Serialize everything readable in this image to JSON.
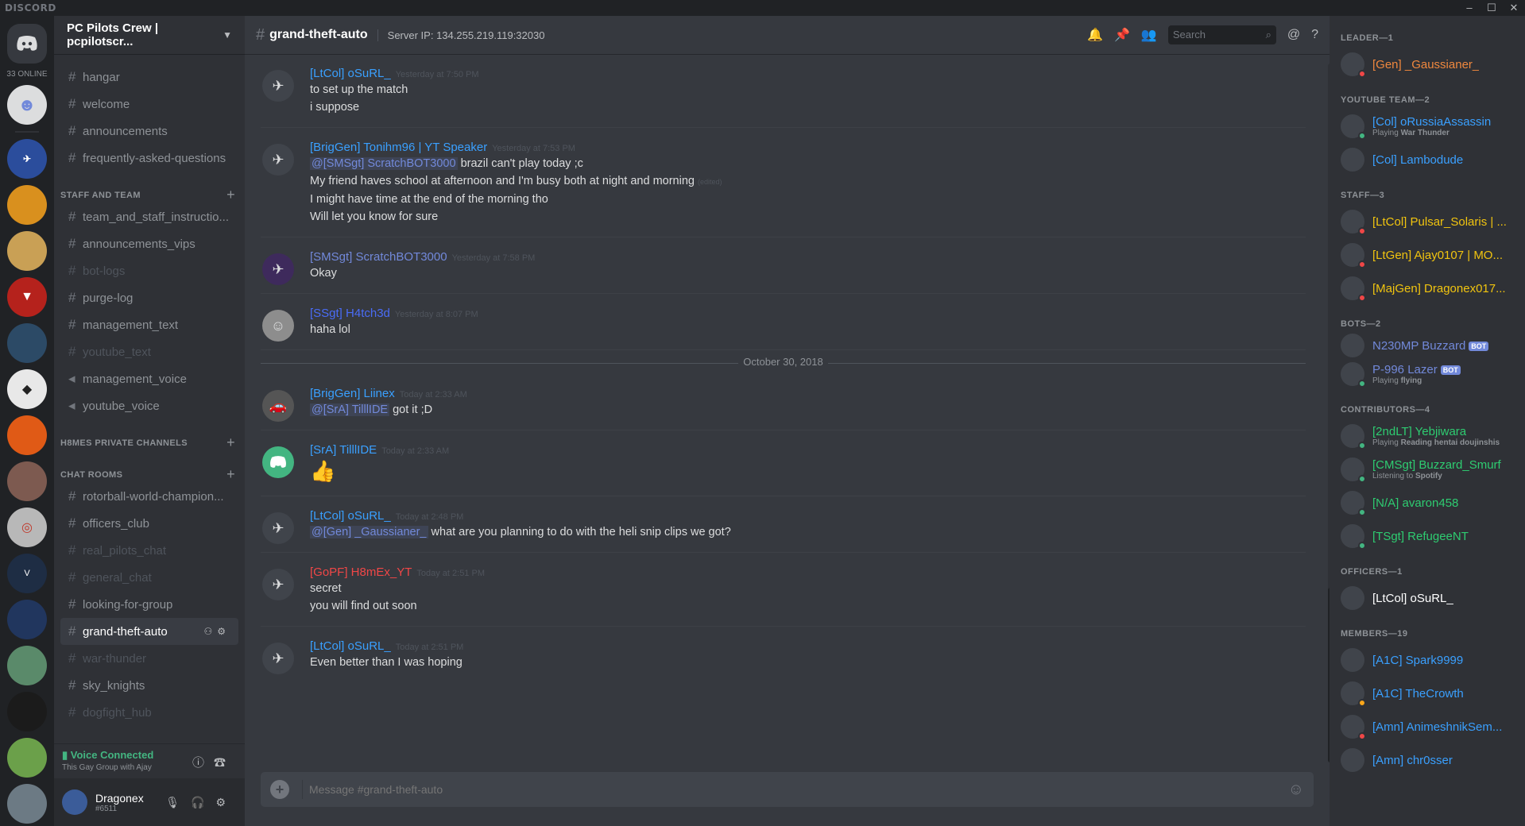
{
  "app": {
    "brand": "DISCORD"
  },
  "servers": {
    "online_count": "33 ONLINE"
  },
  "guild": {
    "name": "PC Pilots Crew | pcpilotscr..."
  },
  "channels": {
    "top": [
      "hangar",
      "welcome",
      "announcements",
      "frequently-asked-questions"
    ],
    "staff_category": "STAFF AND TEAM",
    "staff": [
      "team_and_staff_instructio...",
      "announcements_vips",
      "bot-logs",
      "purge-log",
      "management_text",
      "youtube_text",
      "management_voice",
      "youtube_voice"
    ],
    "h8mes_category": "H8MES PRIVATE CHANNELS",
    "chat_category": "CHAT ROOMS",
    "chat": [
      "rotorball-world-champion...",
      "officers_club",
      "real_pilots_chat",
      "general_chat",
      "looking-for-group",
      "grand-theft-auto",
      "war-thunder",
      "sky_knights",
      "dogfight_hub"
    ]
  },
  "voice": {
    "status": "Voice Connected",
    "channel": "This Gay Group with Ajay"
  },
  "user": {
    "name": "Dragonex",
    "discriminator": "#6511"
  },
  "header": {
    "channel": "grand-theft-auto",
    "topic": "Server IP: 134.255.219.119:32030",
    "search_placeholder": "Search"
  },
  "messages": [
    {
      "author": "[LtCol] oSuRL_",
      "time": "Yesterday at 7:50 PM",
      "lines": [
        "to set up the match",
        "i suppose"
      ]
    },
    {
      "author": "[BrigGen] Tonihm96 | YT Speaker",
      "time": "Yesterday at 7:53 PM",
      "mention": "@[SMSgt] ScratchBOT3000",
      "mention_rest": " brazil can't play today ;c",
      "lines": [
        "My friend haves school at afternoon and I'm busy both at night and morning",
        "I might have time at the end of the morning tho",
        "Will let you know for sure"
      ],
      "edited": "(edited)"
    },
    {
      "author": "[SMSgt] ScratchBOT3000",
      "time": "Yesterday at 7:58 PM",
      "lines": [
        "Okay"
      ]
    },
    {
      "author": "[SSgt] H4tch3d",
      "time": "Yesterday at 8:07 PM",
      "lines": [
        "haha lol"
      ]
    },
    {
      "author": "[BrigGen] Liinex",
      "time": "Today at 2:33 AM",
      "mention": "@[SrA] TilllIDE",
      "mention_rest": " got it ;D"
    },
    {
      "author": "[SrA] TilllIDE",
      "time": "Today at 2:33 AM",
      "emoji": "👍"
    },
    {
      "author": "[LtCol] oSuRL_",
      "time": "Today at 2:48 PM",
      "mention": "@[Gen] _Gaussianer_",
      "mention_rest": " what are you planning to do with the heli snip clips we got?"
    },
    {
      "author": "[GoPF] H8mEx_YT",
      "time": "Today at 2:51 PM",
      "lines": [
        "secret",
        "you will find out soon"
      ]
    },
    {
      "author": "[LtCol] oSuRL_",
      "time": "Today at 2:51 PM",
      "lines": [
        "Even better than I was hoping"
      ]
    }
  ],
  "date_divider": "October 30, 2018",
  "composer": {
    "placeholder": "Message #grand-theft-auto"
  },
  "members": {
    "groups": [
      {
        "title": "LEADER—1",
        "items": [
          {
            "name": "[Gen] _Gaussianer_",
            "color": "#f0883e",
            "status": "#f04747"
          }
        ]
      },
      {
        "title": "YOUTUBE TEAM—2",
        "items": [
          {
            "name": "[Col] oRussiaAssassin",
            "color": "#3aa0ff",
            "status": "#43b581",
            "act_label": "Playing ",
            "act": "War Thunder"
          },
          {
            "name": "[Col] Lambodude",
            "color": "#3aa0ff",
            "status": ""
          }
        ]
      },
      {
        "title": "STAFF—3",
        "items": [
          {
            "name": "[LtCol] Pulsar_Solaris | ...",
            "color": "#f1c40f",
            "status": "#f04747"
          },
          {
            "name": "[LtGen] Ajay0107 | MO...",
            "color": "#f1c40f",
            "status": "#f04747"
          },
          {
            "name": "[MajGen] Dragonex017...",
            "color": "#f1c40f",
            "status": "#f04747"
          }
        ]
      },
      {
        "title": "BOTS—2",
        "items": [
          {
            "name": "N230MP Buzzard",
            "color": "#7289da",
            "status": "",
            "bot": "BOT"
          },
          {
            "name": "P-996 Lazer",
            "color": "#7289da",
            "status": "#43b581",
            "bot": "BOT",
            "act_label": "Playing ",
            "act": "flying"
          }
        ]
      },
      {
        "title": "CONTRIBUTORS—4",
        "items": [
          {
            "name": "[2ndLT] Yebjiwara",
            "color": "#2ecc71",
            "status": "#43b581",
            "act_label": "Playing ",
            "act": "Reading hentai doujinshis"
          },
          {
            "name": "[CMSgt] Buzzard_Smurf",
            "color": "#2ecc71",
            "status": "#43b581",
            "act_label": "Listening to ",
            "act": "Spotify"
          },
          {
            "name": "[N/A] avaron458",
            "color": "#2ecc71",
            "status": "#43b581"
          },
          {
            "name": "[TSgt] RefugeeNT",
            "color": "#2ecc71",
            "status": "#43b581"
          }
        ]
      },
      {
        "title": "OFFICERS—1",
        "items": [
          {
            "name": "[LtCol] oSuRL_",
            "color": "#ffffff",
            "status": ""
          }
        ]
      },
      {
        "title": "MEMBERS—19",
        "items": [
          {
            "name": "[A1C] Spark9999",
            "color": "#3aa0ff",
            "status": ""
          },
          {
            "name": "[A1C] TheCrowth",
            "color": "#3aa0ff",
            "status": "#faa61a"
          },
          {
            "name": "[Amn] AnimeshnikSem...",
            "color": "#3aa0ff",
            "status": "#f04747"
          },
          {
            "name": "[Amn] chr0sser",
            "color": "#3aa0ff",
            "status": ""
          }
        ]
      }
    ]
  },
  "colors": {
    "leader": "#f0883e",
    "youtube": "#3aa0ff",
    "staff": "#f1c40f",
    "bot": "#7289da",
    "contrib": "#2ecc71",
    "osurl": "#3aa0ff",
    "tonihm": "#3aa0ff",
    "scratch": "#7289da",
    "hatched": "#4a6cf7",
    "liinex": "#3aa0ff",
    "tilllide": "#3aa0ff",
    "h8mex": "#f04747"
  }
}
